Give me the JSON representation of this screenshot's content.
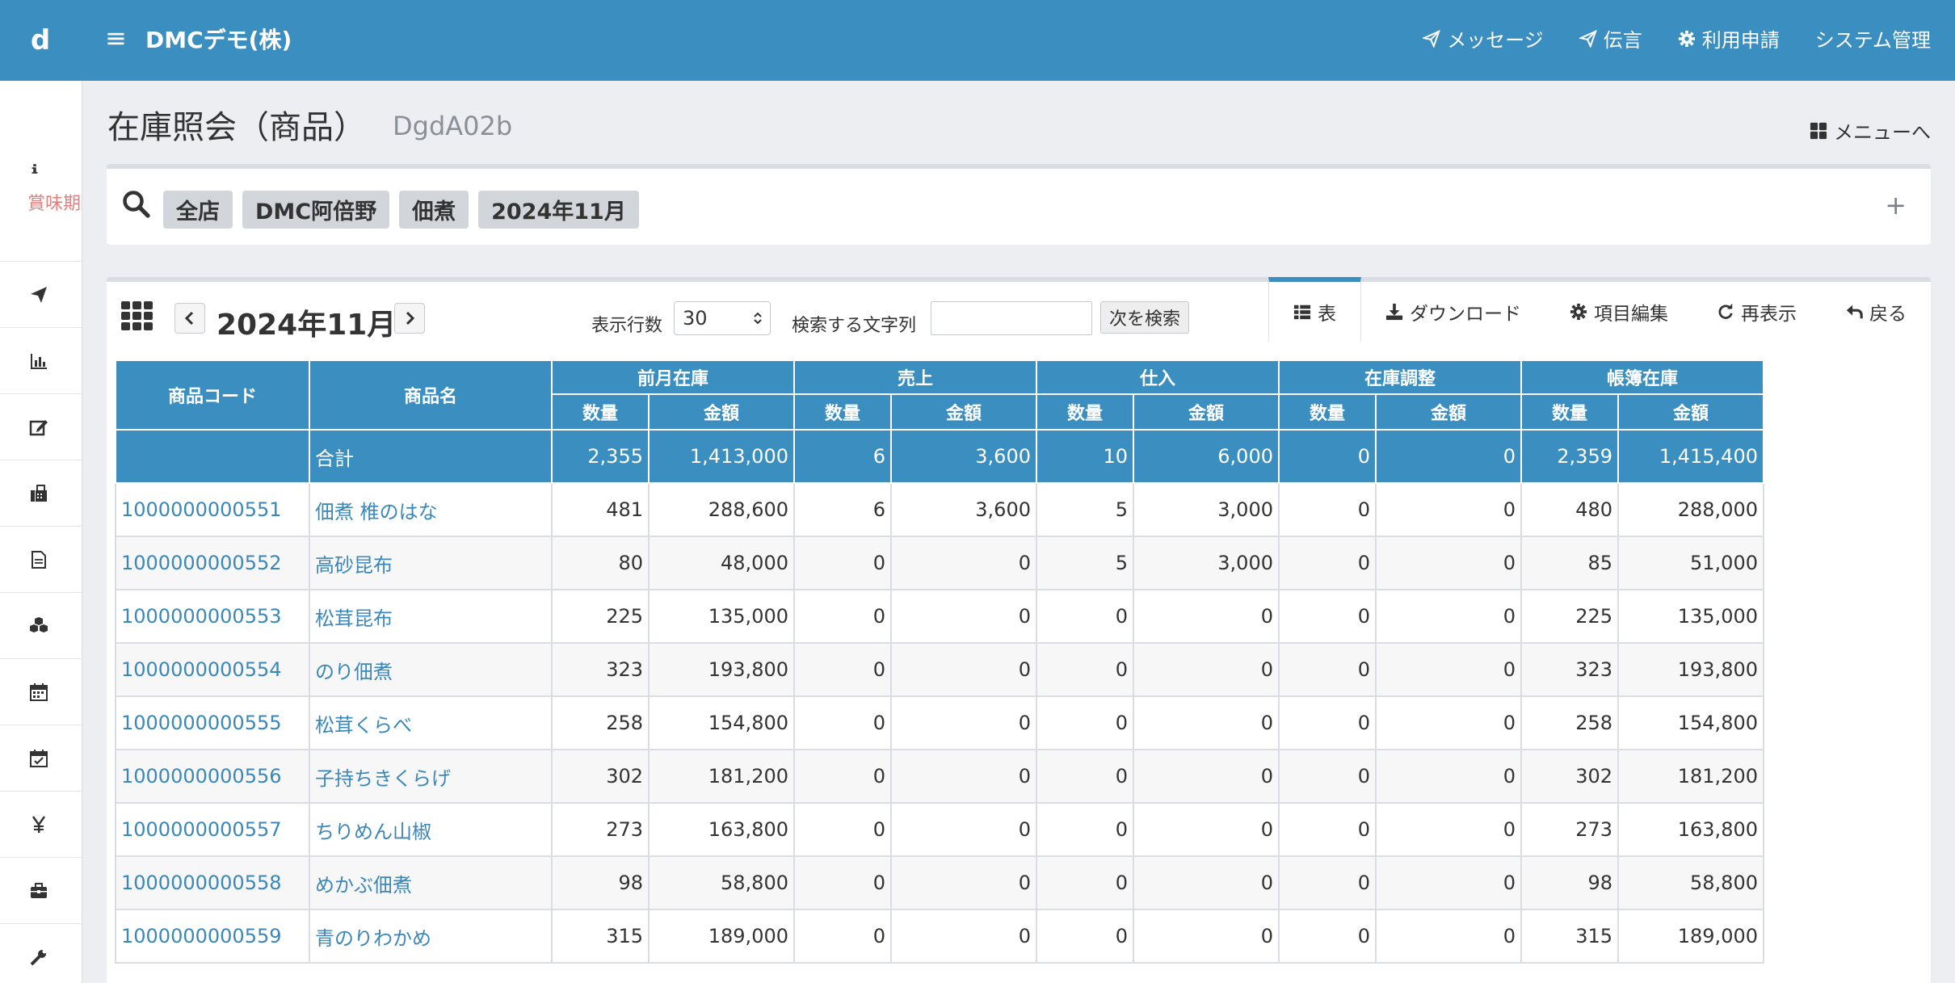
{
  "header": {
    "brand": "d",
    "company": "DMCデモ(株)",
    "nav": [
      {
        "label": "メッセージ",
        "icon": "send-icon"
      },
      {
        "label": "伝言",
        "icon": "send-icon"
      },
      {
        "label": "利用申請",
        "icon": "gear-icon"
      },
      {
        "label": "システム管理",
        "icon": ""
      }
    ]
  },
  "sidebar": {
    "info_label": "賞味期",
    "items": [
      "info-icon",
      "send-icon",
      "bar-chart-icon",
      "edit-icon",
      "fax-icon",
      "document-icon",
      "cubes-icon",
      "calendar-icon",
      "calendar-check-icon",
      "yen-icon",
      "briefcase-icon",
      "wrench-icon"
    ]
  },
  "page": {
    "title": "在庫照会（商品）",
    "code": "DgdA02b",
    "menu_link": "メニューへ"
  },
  "search": {
    "chips": [
      "全店",
      "DMC阿倍野",
      "佃煮",
      "2024年11月"
    ],
    "expand": "+"
  },
  "toolbar": {
    "month": "2024年11月",
    "rows_label": "表示行数",
    "rows_value": "30",
    "find_label": "検索する文字列",
    "find_value": "",
    "find_button": "次を検索",
    "tabs": [
      {
        "label": "表",
        "icon": "table-icon",
        "active": true
      },
      {
        "label": "ダウンロード",
        "icon": "download-icon",
        "active": false
      },
      {
        "label": "項目編集",
        "icon": "gear-icon",
        "active": false
      },
      {
        "label": "再表示",
        "icon": "refresh-icon",
        "active": false
      },
      {
        "label": "戻る",
        "icon": "reply-icon",
        "active": false
      }
    ]
  },
  "table": {
    "col_code": "商品コード",
    "col_name": "商品名",
    "groups": [
      "前月在庫",
      "売上",
      "仕入",
      "在庫調整",
      "帳簿在庫"
    ],
    "sub_qty": "数量",
    "sub_amount": "金額",
    "total": {
      "code": "",
      "name": "合計",
      "values": [
        "2,355",
        "1,413,000",
        "6",
        "3,600",
        "10",
        "6,000",
        "0",
        "0",
        "2,359",
        "1,415,400"
      ]
    },
    "rows": [
      {
        "code": "1000000000551",
        "name": "佃煮 椎のはな",
        "values": [
          "481",
          "288,600",
          "6",
          "3,600",
          "5",
          "3,000",
          "0",
          "0",
          "480",
          "288,000"
        ]
      },
      {
        "code": "1000000000552",
        "name": "高砂昆布",
        "values": [
          "80",
          "48,000",
          "0",
          "0",
          "5",
          "3,000",
          "0",
          "0",
          "85",
          "51,000"
        ]
      },
      {
        "code": "1000000000553",
        "name": "松茸昆布",
        "values": [
          "225",
          "135,000",
          "0",
          "0",
          "0",
          "0",
          "0",
          "0",
          "225",
          "135,000"
        ]
      },
      {
        "code": "1000000000554",
        "name": "のり佃煮",
        "values": [
          "323",
          "193,800",
          "0",
          "0",
          "0",
          "0",
          "0",
          "0",
          "323",
          "193,800"
        ]
      },
      {
        "code": "1000000000555",
        "name": "松茸くらべ",
        "values": [
          "258",
          "154,800",
          "0",
          "0",
          "0",
          "0",
          "0",
          "0",
          "258",
          "154,800"
        ]
      },
      {
        "code": "1000000000556",
        "name": "子持ちきくらげ",
        "values": [
          "302",
          "181,200",
          "0",
          "0",
          "0",
          "0",
          "0",
          "0",
          "302",
          "181,200"
        ]
      },
      {
        "code": "1000000000557",
        "name": "ちりめん山椒",
        "values": [
          "273",
          "163,800",
          "0",
          "0",
          "0",
          "0",
          "0",
          "0",
          "273",
          "163,800"
        ]
      },
      {
        "code": "1000000000558",
        "name": "めかぶ佃煮",
        "values": [
          "98",
          "58,800",
          "0",
          "0",
          "0",
          "0",
          "0",
          "0",
          "98",
          "58,800"
        ]
      },
      {
        "code": "1000000000559",
        "name": "青のりわかめ",
        "values": [
          "315",
          "189,000",
          "0",
          "0",
          "0",
          "0",
          "0",
          "0",
          "315",
          "189,000"
        ]
      }
    ]
  },
  "colors": {
    "primary": "#3b8fc0",
    "link": "#3b87b8",
    "warn_label": "#e58080",
    "background": "#eceef2"
  }
}
